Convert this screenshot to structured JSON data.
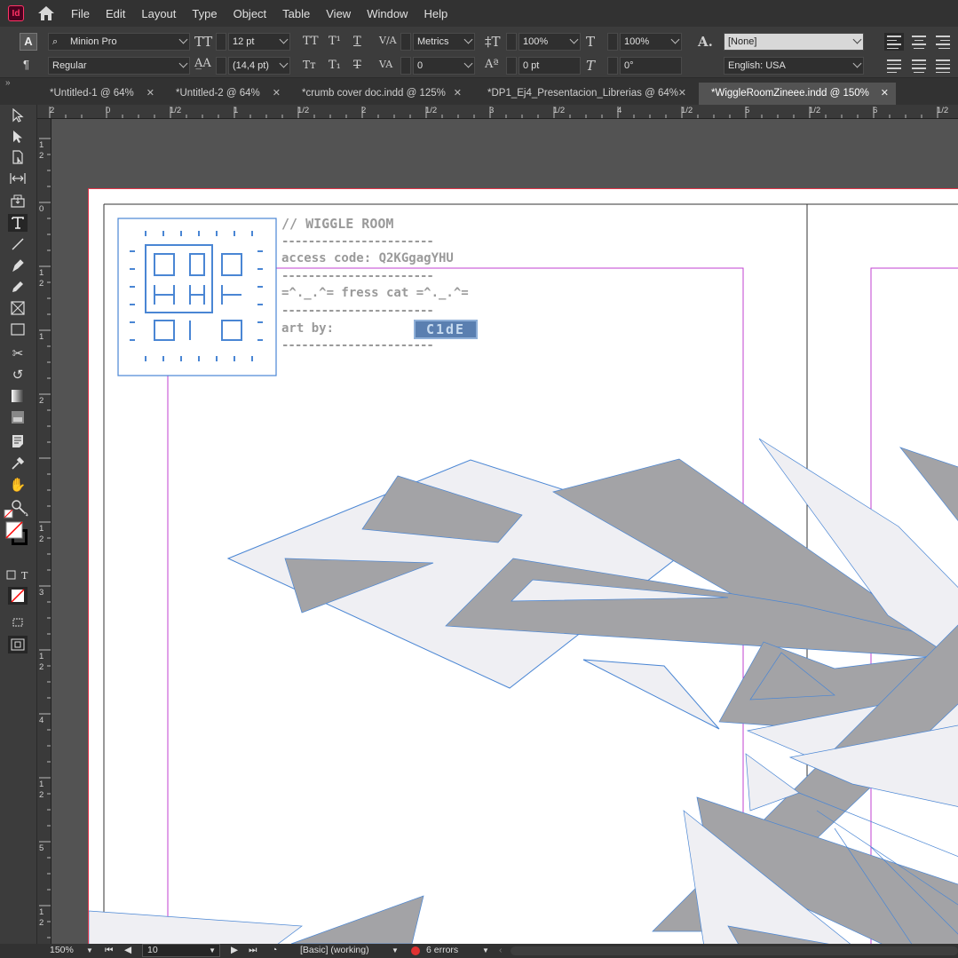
{
  "app": {
    "logo": "Id"
  },
  "menu": [
    "File",
    "Edit",
    "Layout",
    "Type",
    "Object",
    "Table",
    "View",
    "Window",
    "Help"
  ],
  "control": {
    "font_family": "Minion Pro",
    "font_style": "Regular",
    "font_size": "12 pt",
    "leading": "(14,4 pt)",
    "kerning": "Metrics",
    "tracking": "0",
    "vertical_scale": "100%",
    "horizontal_scale": "100%",
    "baseline_shift": "0 pt",
    "skew": "0°",
    "char_style": "[None]",
    "language": "English: USA"
  },
  "tabs": [
    {
      "label": "*Untitled-1 @ 64%",
      "active": false
    },
    {
      "label": "*Untitled-2 @ 64%",
      "active": false
    },
    {
      "label": "*crumb cover doc.indd @ 125%",
      "active": false
    },
    {
      "label": "*DP1_Ej4_Presentacion_Librerias @ 64%",
      "active": false
    },
    {
      "label": "*WiggleRoomZineee.indd @ 150%",
      "active": true
    }
  ],
  "ruler_h": [
    "2",
    "0",
    "1/2",
    "1",
    "1/2",
    "2",
    "1/2",
    "3",
    "1/2",
    "4",
    "1/2",
    "5",
    "1/2",
    "6",
    "1/2"
  ],
  "ruler_v": [
    "1",
    "2",
    "0",
    "1",
    "2",
    "1",
    "2",
    "1",
    "2",
    "3",
    "1",
    "2",
    "4",
    "1",
    "2",
    "5",
    "1",
    "2"
  ],
  "document": {
    "title": "//  WIGGLE ROOM",
    "access_code": "access code: Q2KGgagYHU",
    "fress_cat": "=^._.^= fress cat =^._.^=",
    "art_by": "art by:",
    "badge": "C1dE",
    "dash_line": "-----------------------"
  },
  "status": {
    "zoom": "150%",
    "page": "10",
    "preflight_profile": "[Basic] (working)",
    "errors": "6 errors"
  },
  "colors": {
    "shape_gray": "#a3a3a6",
    "shape_light": "#efeff3",
    "frame_blue": "#4a86d4",
    "margin_magenta": "#c040d0",
    "bleed_red": "#e0354a"
  }
}
